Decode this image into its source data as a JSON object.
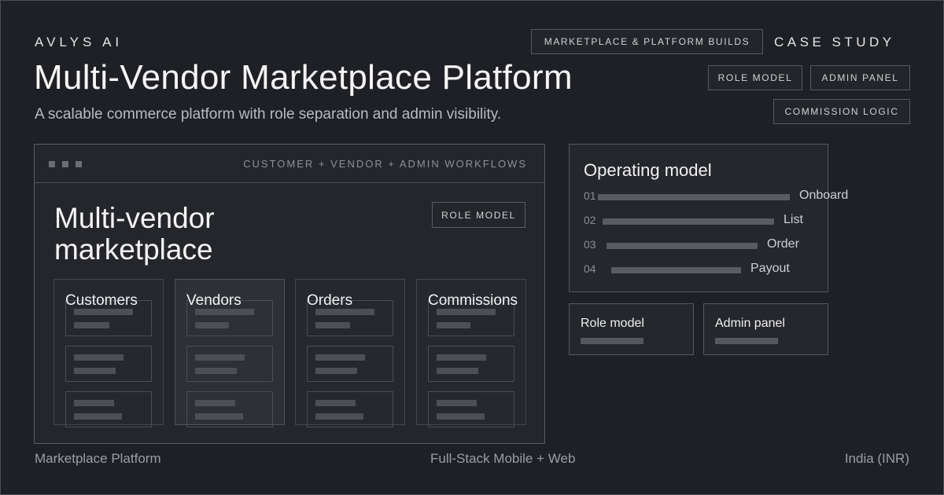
{
  "header": {
    "brand": "AVLYS AI",
    "category_tag": "MARKETPLACE & PLATFORM BUILDS",
    "case_study": "CASE STUDY",
    "title": "Multi-Vendor Marketplace Platform",
    "subtitle": "A scalable commerce platform with role separation and admin visibility.",
    "tags": [
      "ROLE MODEL",
      "ADMIN PANEL",
      "COMMISSION LOGIC"
    ]
  },
  "mock": {
    "caption": "CUSTOMER + VENDOR + ADMIN WORKFLOWS",
    "title": "Multi-vendor marketplace",
    "badge": "ROLE MODEL",
    "columns": [
      {
        "label": "Customers",
        "active": false
      },
      {
        "label": "Vendors",
        "active": true
      },
      {
        "label": "Orders",
        "active": false
      },
      {
        "label": "Commissions",
        "active": false
      }
    ]
  },
  "operating_model": {
    "title": "Operating model",
    "steps": [
      {
        "num": "01",
        "label": "Onboard"
      },
      {
        "num": "02",
        "label": "List"
      },
      {
        "num": "03",
        "label": "Order"
      },
      {
        "num": "04",
        "label": "Payout"
      }
    ]
  },
  "mini_cards": [
    "Role model",
    "Admin panel"
  ],
  "footer": {
    "left": "Marketplace Platform",
    "center": "Full-Stack Mobile + Web",
    "right": "India (INR)"
  }
}
